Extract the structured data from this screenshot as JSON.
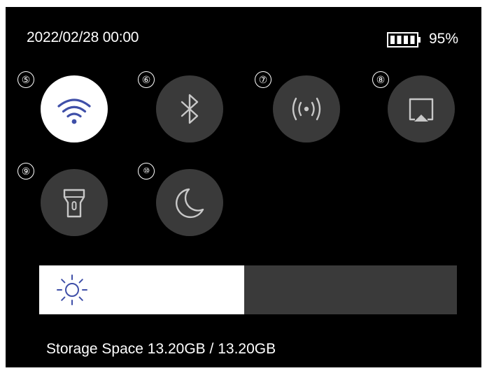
{
  "status_bar": {
    "datetime": "2022/02/28 00:00",
    "battery_percent": "95%",
    "battery_level": 0.95
  },
  "quick_settings": [
    {
      "number": "⑤",
      "icon": "wifi-icon",
      "active": true
    },
    {
      "number": "⑥",
      "icon": "bluetooth-icon",
      "active": false
    },
    {
      "number": "⑦",
      "icon": "hotspot-icon",
      "active": false
    },
    {
      "number": "⑧",
      "icon": "screen-cast-icon",
      "active": false
    },
    {
      "number": "⑨",
      "icon": "flashlight-icon",
      "active": false
    },
    {
      "number": "⑩",
      "icon": "moon-icon",
      "active": false
    }
  ],
  "brightness": {
    "icon": "sun-icon",
    "level": 0.49
  },
  "storage": {
    "label": "Storage Space",
    "used": "13.20GB",
    "separator": "/",
    "total": "13.20GB"
  },
  "colors": {
    "background": "#000000",
    "tile_inactive": "#3a3a3a",
    "tile_active": "#ffffff",
    "accent_blue": "#3f4fa8",
    "icon_gray": "#c8c8c8"
  }
}
